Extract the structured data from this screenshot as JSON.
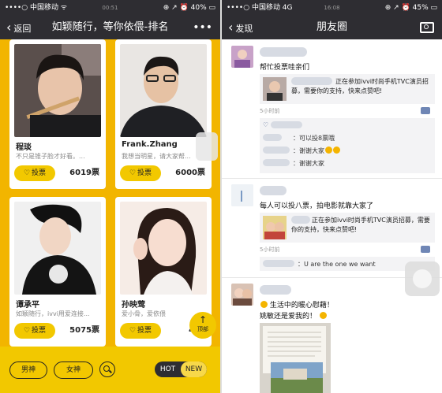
{
  "left_screen": {
    "status": {
      "carrier": "••••○ 中国移动 ᯤ",
      "time": "00:51",
      "battery": "⊕ ↗ ⏰ 40% ▭"
    },
    "nav": {
      "back_label": "返回",
      "title": "如颖随行，等你依偎-排名",
      "more": "•••"
    },
    "cards": [
      {
        "name": "程琰",
        "desc": "不只是锥子脸才好看。...",
        "vote_label": "投票",
        "votes": "6019票"
      },
      {
        "name": "Frank.Zhang",
        "desc": "我想当明星，请大家帮...",
        "vote_label": "投票",
        "votes": "6000票"
      },
      {
        "name": "谭承平",
        "desc": "如颖随行，ivvi用爱连接...",
        "vote_label": "投票",
        "votes": "5075票"
      },
      {
        "name": "孙映莺",
        "desc": "爱小骨，爱依偎",
        "vote_label": "投票",
        "votes": "459"
      }
    ],
    "top_button_label": "顶部",
    "filters": {
      "male": "男神",
      "female": "女神"
    },
    "toggle": {
      "hot": "HOT",
      "new": "NEW"
    }
  },
  "right_screen": {
    "status": {
      "carrier": "••••○ 中国移动 4G",
      "time": "16:08",
      "battery": "⊕ ↗ ⏰ 45% ▭"
    },
    "nav": {
      "back_label": "发现",
      "title": "朋友圈"
    },
    "posts": [
      {
        "text": "帮忙投票哇亲们",
        "share_text": "正在参加ivvi时尚手机TVC演员招募，需要你的支持，快来点赞吧!",
        "time": "5小时前",
        "comments": [
          {
            "text": "：可以投8票哦"
          },
          {
            "text": "：谢谢大家"
          },
          {
            "text": "：谢谢大家"
          }
        ]
      },
      {
        "text": "每人可以投八票，拍电影就靠大家了",
        "share_text": "正在参加ivvi时尚手机TVC演员招募，需要你的支持，快来点赞吧!",
        "time": "5小时前",
        "comments": [
          {
            "text": "：U are the one we want"
          }
        ]
      },
      {
        "line1": "生活中的暖心慰藉！",
        "line2": "姚敏还是爱我的！"
      }
    ]
  },
  "colors": {
    "brand_yellow": "#f2c800",
    "nav_dark": "#2e2d32",
    "link_blue": "#576b95"
  }
}
